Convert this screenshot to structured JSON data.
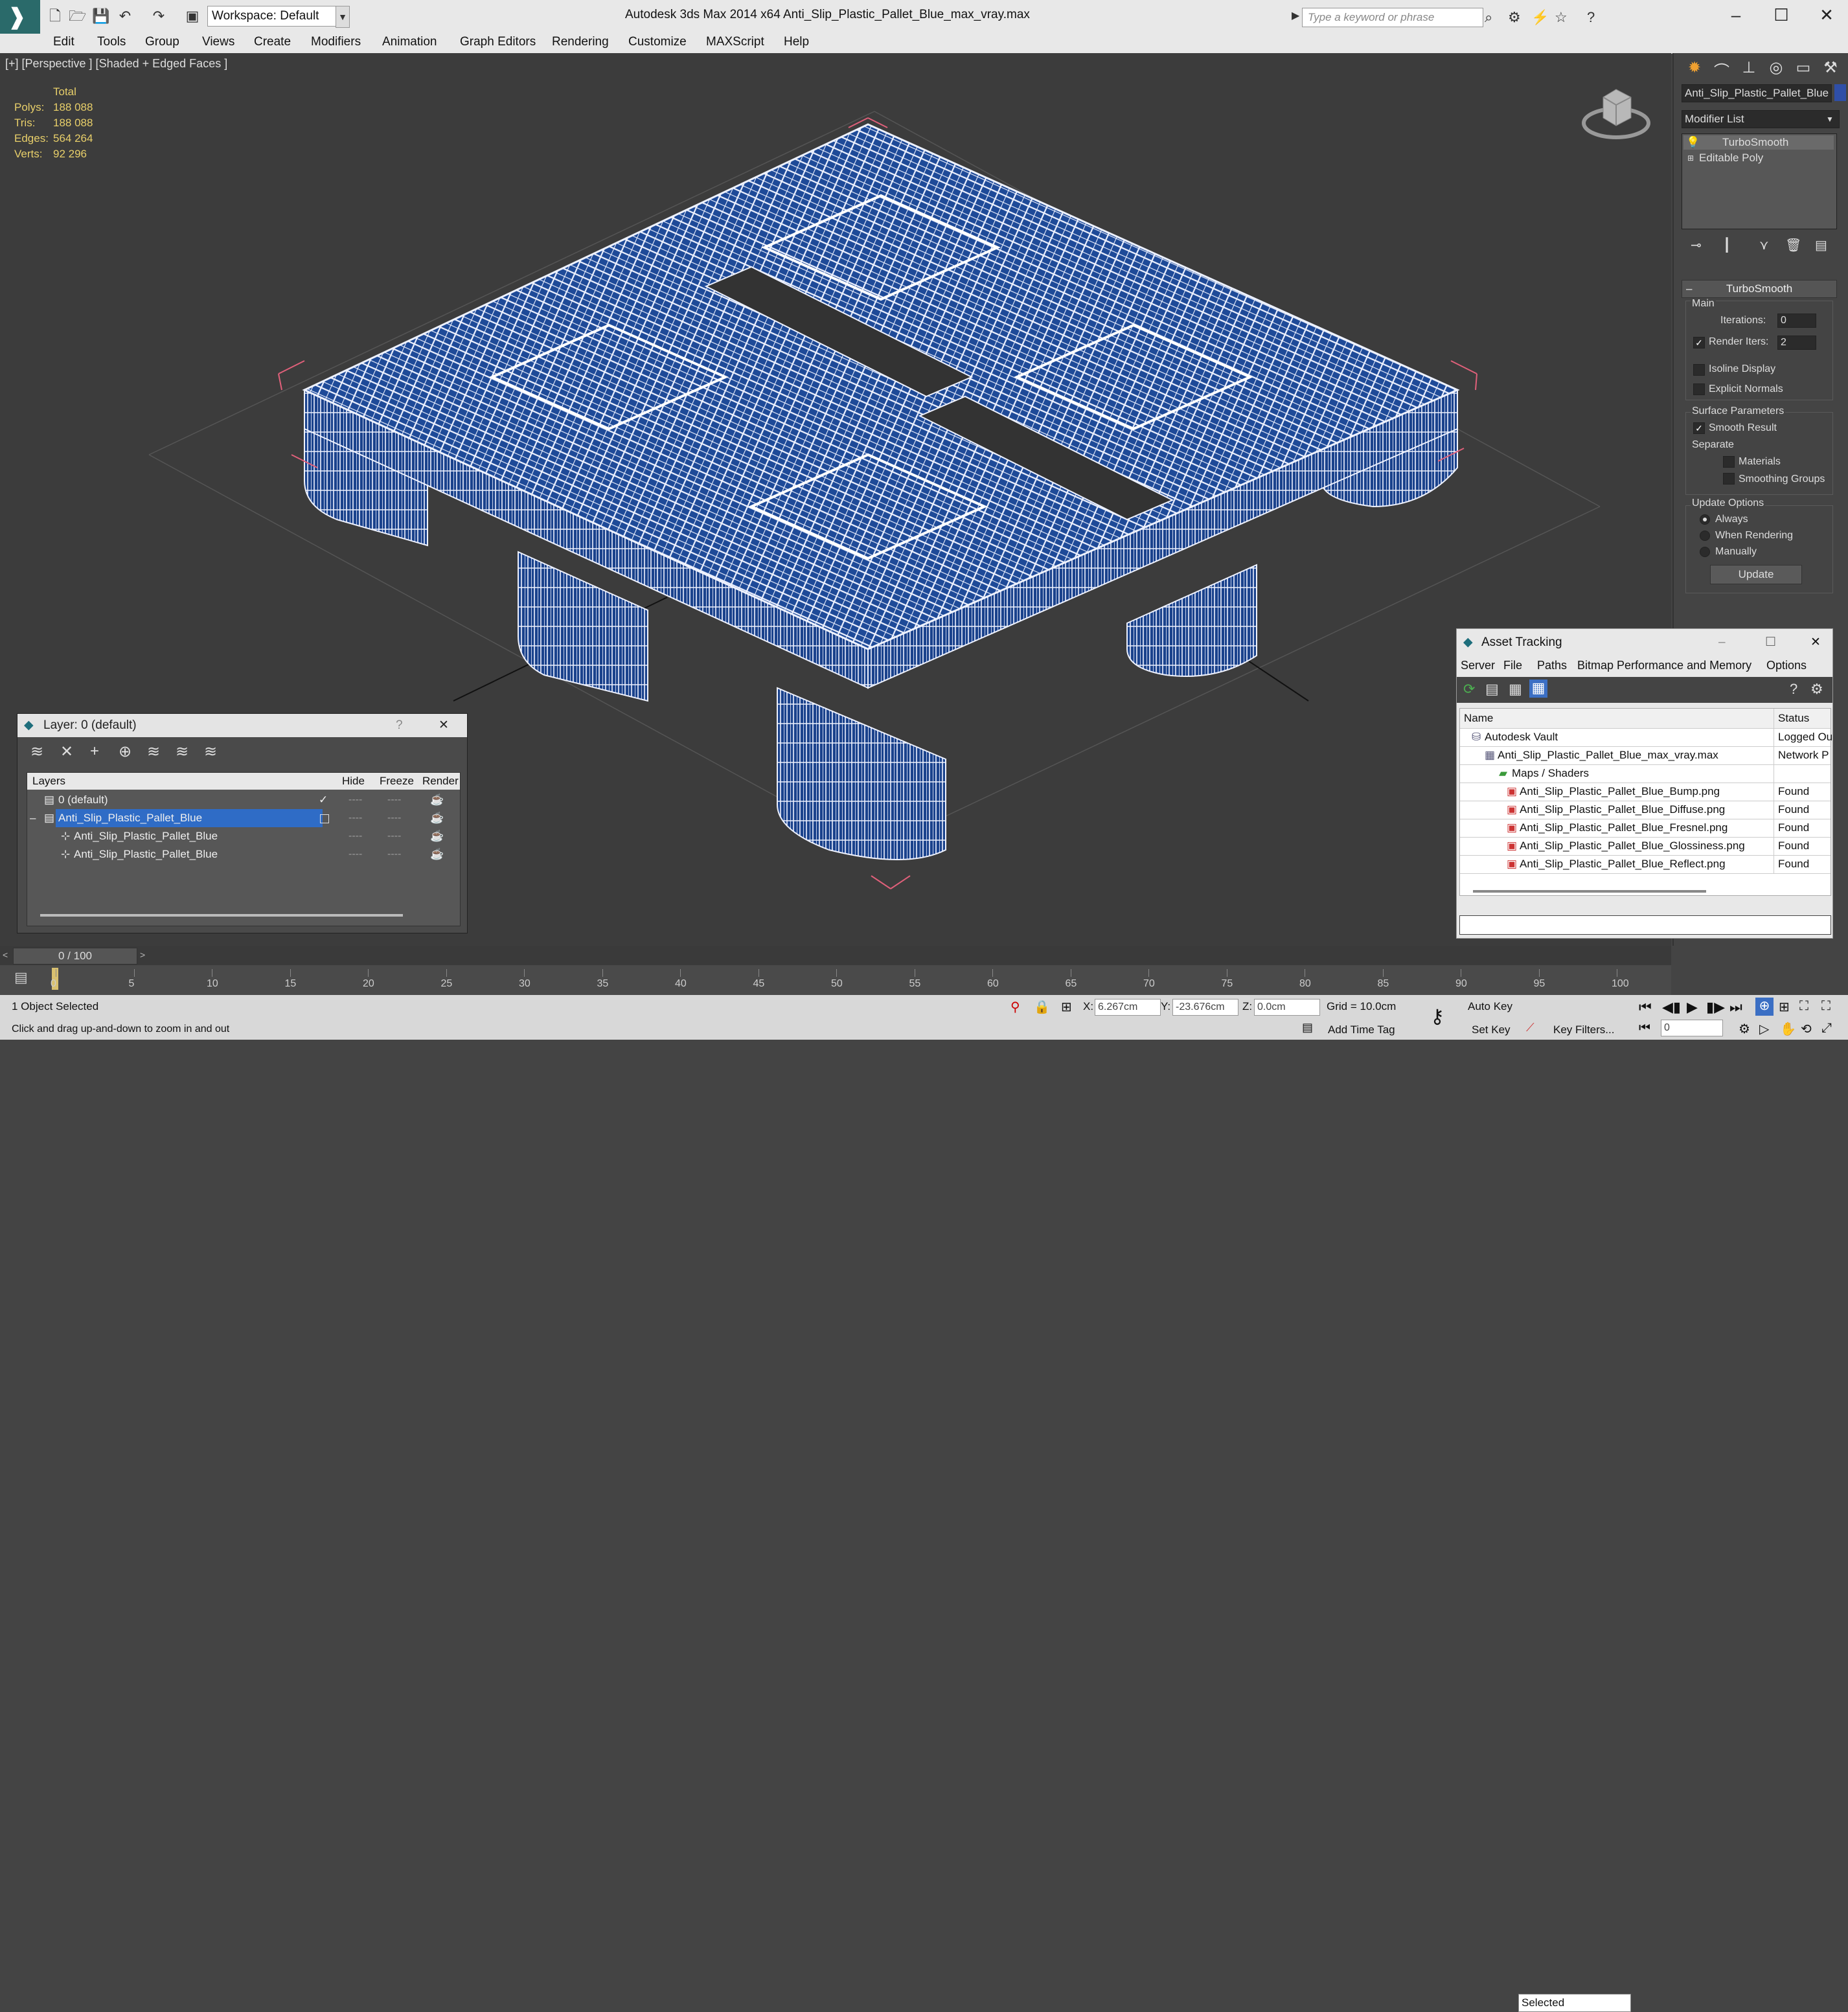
{
  "title_bar": {
    "workspace": "Workspace: Default",
    "app_title": "Autodesk 3ds Max  2014 x64      Anti_Slip_Plastic_Pallet_Blue_max_vray.max",
    "search_placeholder": "Type a keyword or phrase"
  },
  "menu": [
    "Edit",
    "Tools",
    "Group",
    "Views",
    "Create",
    "Modifiers",
    "Animation",
    "Graph Editors",
    "Rendering",
    "Customize",
    "MAXScript",
    "Help"
  ],
  "viewport": {
    "label": "[+] [Perspective ] [Shaded + Edged Faces ]",
    "stats_header": "Total",
    "stats": [
      {
        "k": "Polys:",
        "v": "188 088"
      },
      {
        "k": "Tris:",
        "v": "188 088"
      },
      {
        "k": "Edges:",
        "v": "564 264"
      },
      {
        "k": "Verts:",
        "v": "92 296"
      }
    ],
    "mesh_color": "#1f4fa0",
    "wire_color": "#e6ecff"
  },
  "command_panel": {
    "object_name": "Anti_Slip_Plastic_Pallet_Blue",
    "object_color": "#2f4fa8",
    "modifier_list": "Modifier List",
    "stack": [
      "TurboSmooth",
      "Editable Poly"
    ],
    "rollout_title": "TurboSmooth",
    "main_label": "Main",
    "iterations_label": "Iterations:",
    "iterations_value": "0",
    "render_iters_label": "Render Iters:",
    "render_iters_value": "2",
    "isoline": "Isoline Display",
    "explicit_normals": "Explicit Normals",
    "surface_params": "Surface Parameters",
    "smooth_result": "Smooth Result",
    "separate": "Separate",
    "materials": "Materials",
    "smoothing_groups": "Smoothing Groups",
    "update_options": "Update Options",
    "always": "Always",
    "when_rendering": "When Rendering",
    "manually": "Manually",
    "update_button": "Update"
  },
  "layer_window": {
    "title": "Layer: 0 (default)",
    "headers": {
      "layers": "Layers",
      "hide": "Hide",
      "freeze": "Freeze",
      "render": "Render"
    },
    "rows": [
      {
        "name": "0 (default)"
      },
      {
        "name": "Anti_Slip_Plastic_Pallet_Blue"
      },
      {
        "name": "Anti_Slip_Plastic_Pallet_Blue"
      },
      {
        "name": "Anti_Slip_Plastic_Pallet_Blue"
      }
    ]
  },
  "asset_tracking": {
    "title": "Asset Tracking",
    "menu": [
      "Server",
      "File",
      "Paths",
      "Bitmap Performance and Memory",
      "Options"
    ],
    "headers": {
      "name": "Name",
      "status": "Status"
    },
    "rows": [
      {
        "name": "Autodesk Vault",
        "status": "Logged Ou"
      },
      {
        "name": "Anti_Slip_Plastic_Pallet_Blue_max_vray.max",
        "status": "Network P"
      },
      {
        "name": "Maps / Shaders",
        "status": ""
      },
      {
        "name": "Anti_Slip_Plastic_Pallet_Blue_Bump.png",
        "status": "Found"
      },
      {
        "name": "Anti_Slip_Plastic_Pallet_Blue_Diffuse.png",
        "status": "Found"
      },
      {
        "name": "Anti_Slip_Plastic_Pallet_Blue_Fresnel.png",
        "status": "Found"
      },
      {
        "name": "Anti_Slip_Plastic_Pallet_Blue_Glossiness.png",
        "status": "Found"
      },
      {
        "name": "Anti_Slip_Plastic_Pallet_Blue_Reflect.png",
        "status": "Found"
      }
    ]
  },
  "timeline": {
    "position": "0 / 100",
    "ticks": [
      "0",
      "5",
      "10",
      "15",
      "20",
      "25",
      "30",
      "35",
      "40",
      "45",
      "50",
      "55",
      "60",
      "65",
      "70",
      "75",
      "80",
      "85",
      "90",
      "95",
      "100"
    ]
  },
  "status": {
    "selected": "1 Object Selected",
    "hint": "Click and drag up-and-down to zoom in and out",
    "x_label": "X:",
    "x": "6.267cm",
    "y_label": "Y:",
    "y": "-23.676cm",
    "z_label": "Z:",
    "z": "0.0cm",
    "grid": "Grid = 10.0cm",
    "add_time_tag": "Add Time Tag",
    "auto_key": "Auto Key",
    "set_key": "Set Key",
    "selection": "Selected",
    "key_filters": "Key Filters...",
    "frame": "0"
  }
}
